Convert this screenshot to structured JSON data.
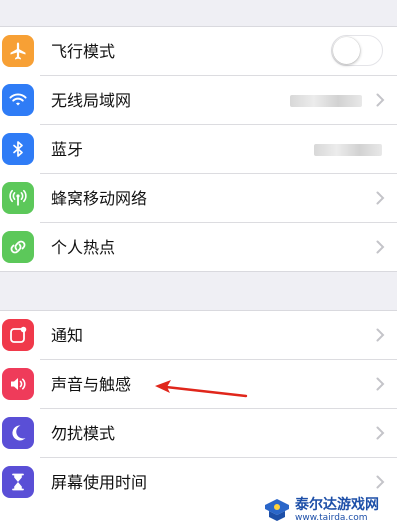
{
  "group1": [
    {
      "label": "飞行模式",
      "icon": "airplane-icon",
      "color": "#f7a035",
      "accessory": "toggle",
      "toggle_on": false
    },
    {
      "label": "无线局域网",
      "icon": "wifi-icon",
      "color": "#2f7cf6",
      "accessory": "value-chevron"
    },
    {
      "label": "蓝牙",
      "icon": "bluetooth-icon",
      "color": "#2f7cf6",
      "accessory": "value"
    },
    {
      "label": "蜂窝移动网络",
      "icon": "antenna-icon",
      "color": "#5cc85a",
      "accessory": "chevron"
    },
    {
      "label": "个人热点",
      "icon": "hotspot-icon",
      "color": "#5cc85a",
      "accessory": "chevron"
    }
  ],
  "group2": [
    {
      "label": "通知",
      "icon": "notification-icon",
      "color": "#f0394a",
      "accessory": "chevron"
    },
    {
      "label": "声音与触感",
      "icon": "speaker-icon",
      "color": "#ef3b5a",
      "accessory": "chevron"
    },
    {
      "label": "勿扰模式",
      "icon": "moon-icon",
      "color": "#5a4fd6",
      "accessory": "chevron"
    },
    {
      "label": "屏幕使用时间",
      "icon": "hourglass-icon",
      "color": "#5a4fd6",
      "accessory": "chevron"
    }
  ],
  "annotation": {
    "color": "#e0261b"
  },
  "watermark": {
    "title": "泰尔达游戏网",
    "url": "www.tairda.com",
    "color": "#1d4fa8"
  }
}
